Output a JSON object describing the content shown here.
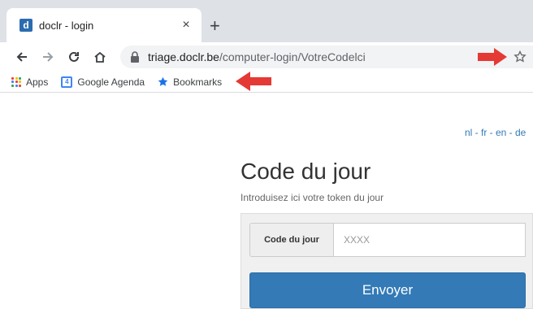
{
  "browser": {
    "tab": {
      "favicon_letter": "d",
      "title": "doclr - login",
      "close_glyph": "×"
    },
    "new_tab_glyph": "+",
    "address": {
      "host": "triage.doclr.be",
      "path": "/computer-login/VotreCodelci"
    },
    "bookmarks": [
      {
        "label": "Apps",
        "icon": "apps-grid-icon"
      },
      {
        "label": "Google Agenda",
        "icon": "calendar-icon",
        "icon_text": "4"
      },
      {
        "label": "Bookmarks",
        "icon": "star-icon"
      }
    ],
    "annotation_color": "#e53935"
  },
  "page": {
    "language_links": "nl - fr - en - de",
    "title": "Code du jour",
    "subtitle": "Introduisez ici votre token du jour",
    "form": {
      "code_label": "Code du jour",
      "code_placeholder": "XXXX",
      "submit_label": "Envoyer"
    },
    "colors": {
      "primary": "#337ab7",
      "link": "#337ab7"
    }
  }
}
